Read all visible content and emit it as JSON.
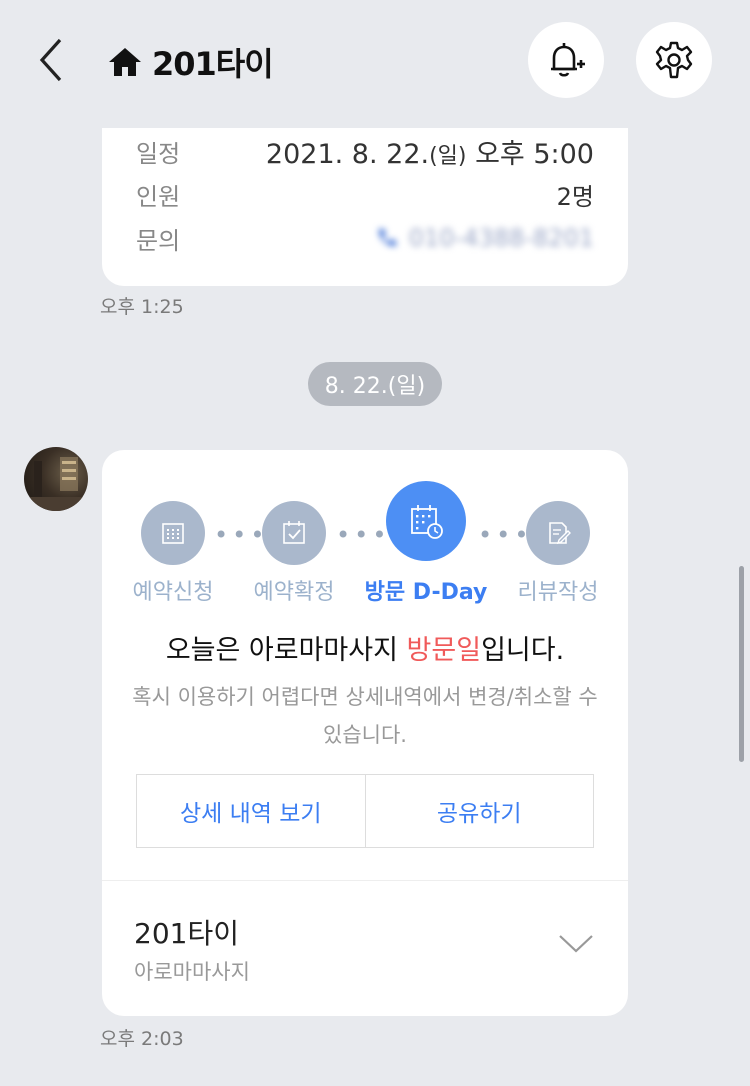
{
  "header": {
    "title": "201타이",
    "icons": {
      "back": "back-arrow-icon",
      "home": "home-icon",
      "bell": "bell-plus-icon",
      "gear": "gear-icon"
    }
  },
  "card_info": {
    "schedule_label": "일정",
    "schedule_date": "2021. 8. 22.",
    "schedule_day": "(일)",
    "schedule_time": "오후 5:00",
    "people_label": "인원",
    "people_value": "2명",
    "contact_label": "문의",
    "contact_value": "010-4388-8201"
  },
  "time_1": "오후 1:25",
  "date_pill": "8. 22.(일)",
  "steps": [
    "예약신청",
    "예약확정",
    "방문 D-Day",
    "리뷰작성"
  ],
  "active_step": 2,
  "message": {
    "before": "오늘은 아로마마사지 ",
    "highlight": "방문일",
    "after": "입니다."
  },
  "sub_message": "혹시 이용하기 어렵다면 상세내역에서 변경/취소할 수 있습니다.",
  "buttons": {
    "detail": "상세 내역 보기",
    "share": "공유하기"
  },
  "shop": {
    "name": "201타이",
    "category": "아로마마사지"
  },
  "time_2": "오후 2:03",
  "colors": {
    "accent": "#3c7ef2",
    "highlight": "#f05a5a",
    "step_inactive": "#aab8cc"
  }
}
